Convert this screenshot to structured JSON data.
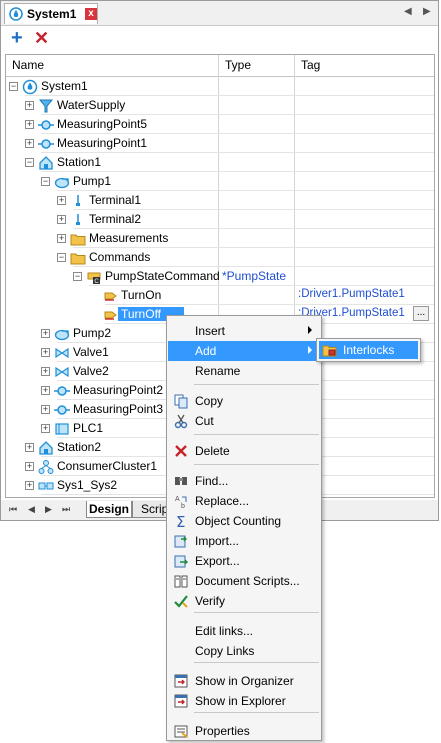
{
  "window": {
    "tab_title": "System1",
    "close_glyph": "x",
    "nav_left": "◀",
    "nav_right": "▶"
  },
  "toolbar": {
    "add_glyph": "+",
    "delete_glyph": "✕"
  },
  "columns": {
    "name": "Name",
    "type": "Type",
    "tag": "Tag"
  },
  "tree": [
    {
      "label": "System1",
      "expander": "−",
      "icon": "system-icon"
    },
    {
      "label": "WaterSupply",
      "expander": "+",
      "icon": "water-supply-icon"
    },
    {
      "label": "MeasuringPoint5",
      "expander": "+",
      "icon": "measuring-point-icon"
    },
    {
      "label": "MeasuringPoint1",
      "expander": "+",
      "icon": "measuring-point-icon"
    },
    {
      "label": "Station1",
      "expander": "−",
      "icon": "station-icon"
    },
    {
      "label": "Pump1",
      "expander": "−",
      "icon": "pump-icon"
    },
    {
      "label": "Terminal1",
      "expander": "+",
      "icon": "terminal-icon"
    },
    {
      "label": "Terminal2",
      "expander": "+",
      "icon": "terminal-icon"
    },
    {
      "label": "Measurements",
      "expander": "+",
      "icon": "folder-icon"
    },
    {
      "label": "Commands",
      "expander": "−",
      "icon": "folder-icon"
    },
    {
      "label": "PumpStateCommand",
      "expander": "−",
      "icon": "command-icon",
      "type": "*PumpState"
    },
    {
      "label": "TurnOn",
      "expander": "",
      "icon": "command-value-icon",
      "tag": ":Driver1.PumpState1"
    },
    {
      "label": "TurnOff",
      "expander": "",
      "icon": "command-value-icon",
      "tag": ":Driver1.PumpState1",
      "ellipsis": "..."
    },
    {
      "label": "Pump2",
      "expander": "+",
      "icon": "pump-icon"
    },
    {
      "label": "Valve1",
      "expander": "+",
      "icon": "valve-icon"
    },
    {
      "label": "Valve2",
      "expander": "+",
      "icon": "valve-icon"
    },
    {
      "label": "MeasuringPoint2",
      "expander": "+",
      "icon": "measuring-point-icon"
    },
    {
      "label": "MeasuringPoint3",
      "expander": "+",
      "icon": "measuring-point-icon"
    },
    {
      "label": "PLC1",
      "expander": "+",
      "icon": "plc-icon"
    },
    {
      "label": "Station2",
      "expander": "+",
      "icon": "station-icon"
    },
    {
      "label": "ConsumerCluster1",
      "expander": "+",
      "icon": "consumer-cluster-icon"
    },
    {
      "label": "Sys1_Sys2",
      "expander": "+",
      "icon": "link-icon"
    }
  ],
  "bottom_tabs": {
    "design": "Design",
    "scripts": "Scripts",
    "nav": [
      "⏮",
      "◀",
      "▶",
      "⏭"
    ]
  },
  "context_menu": [
    {
      "label": "Insert",
      "submenu": true
    },
    {
      "label": "Add",
      "submenu": true,
      "highlighted": true
    },
    {
      "label": "Rename"
    },
    {
      "label": "Copy",
      "icon": "copy-icon"
    },
    {
      "label": "Cut",
      "icon": "cut-icon"
    },
    {
      "label": "Delete",
      "icon": "delete-icon"
    },
    {
      "label": "Find...",
      "icon": "find-icon"
    },
    {
      "label": "Replace...",
      "icon": "replace-icon"
    },
    {
      "label": "Object Counting",
      "icon": "sigma-icon"
    },
    {
      "label": "Import...",
      "icon": "import-icon"
    },
    {
      "label": "Export...",
      "icon": "export-icon"
    },
    {
      "label": "Document Scripts...",
      "icon": "document-scripts-icon"
    },
    {
      "label": "Verify",
      "icon": "verify-icon"
    },
    {
      "label": "Edit links..."
    },
    {
      "label": "Copy Links"
    },
    {
      "label": "Show in Organizer",
      "icon": "organizer-icon"
    },
    {
      "label": "Show in Explorer",
      "icon": "explorer-icon"
    },
    {
      "label": "Properties",
      "icon": "properties-icon"
    }
  ],
  "submenu": [
    {
      "label": "Interlocks",
      "icon": "interlocks-folder-icon"
    }
  ],
  "colors": {
    "accent": "#3399ff",
    "tag_text": "#1f4fd0",
    "icon_blue": "#1f8fd8",
    "delete_red": "#c3242a"
  }
}
